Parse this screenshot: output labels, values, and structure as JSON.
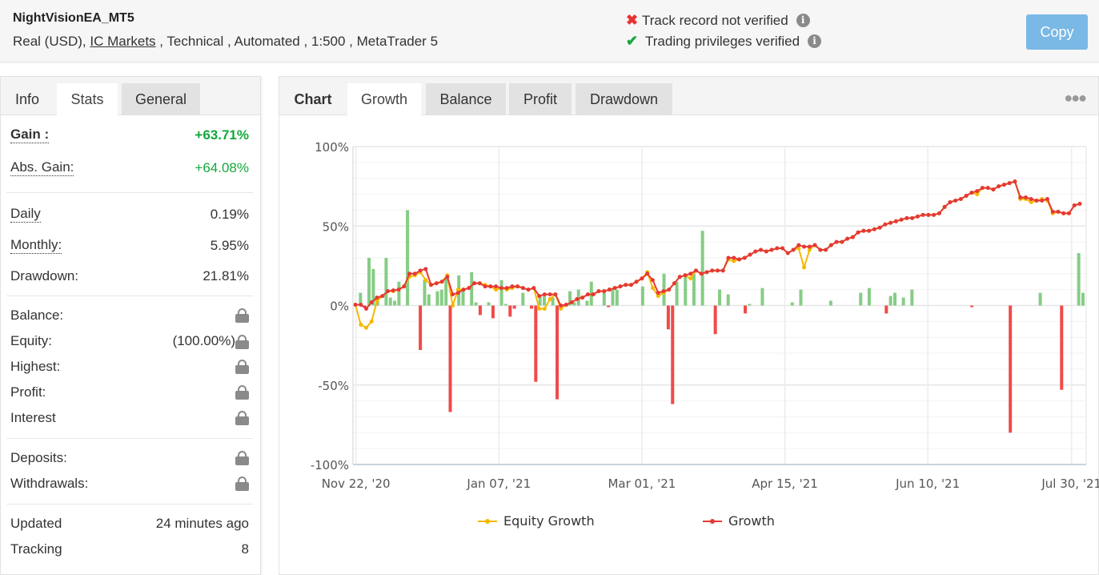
{
  "header": {
    "system_name": "NightVisionEA_MT5",
    "account_type": "Real (USD),",
    "broker": "IC Markets",
    "meta_rest": " , Technical , Automated , 1:500 , MetaTrader 5",
    "verifications": [
      {
        "status": "fail",
        "icon": "x-icon",
        "label": "Track record not verified"
      },
      {
        "status": "ok",
        "icon": "check-icon",
        "label": "Trading privileges verified"
      }
    ],
    "copy_label": "Copy"
  },
  "left_panel": {
    "tabs": [
      "Info",
      "Stats",
      "General"
    ],
    "active_tab": "Stats",
    "gain_label": "Gain :",
    "gain_value": "+63.71%",
    "abs_gain_label": "Abs. Gain:",
    "abs_gain_value": "+64.08%",
    "daily_label": "Daily",
    "daily_value": "0.19%",
    "monthly_label": "Monthly:",
    "monthly_value": "5.95%",
    "drawdown_label": "Drawdown:",
    "drawdown_value": "21.81%",
    "balance_label": "Balance:",
    "equity_label": "Equity:",
    "equity_value": "(100.00%)",
    "highest_label": "Highest:",
    "profit_label": "Profit:",
    "interest_label": "Interest",
    "deposits_label": "Deposits:",
    "withdrawals_label": "Withdrawals:",
    "updated_label": "Updated",
    "updated_value": "24 minutes ago",
    "tracking_label": "Tracking",
    "tracking_value": "8"
  },
  "chart_panel": {
    "tabs": [
      "Chart",
      "Growth",
      "Balance",
      "Profit",
      "Drawdown"
    ],
    "active_tab": "Growth",
    "more_icon": "more-dots-icon"
  },
  "colors": {
    "growth": "#e53935",
    "equity": "#f5b800",
    "bar_pos": "#86cc86",
    "bar_neg": "#f04a4a"
  },
  "chart_data": {
    "type": "line",
    "title": "",
    "xlabel": "",
    "ylabel": "",
    "ylim": [
      -100,
      100
    ],
    "yticks": [
      "100%",
      "50%",
      "0%",
      "-50%",
      "-100%"
    ],
    "ytick_values": [
      100,
      50,
      0,
      -50,
      -100
    ],
    "xticks": [
      "Nov 22, '20",
      "Jan 07, '21",
      "Mar 01, '21",
      "Apr 15, '21",
      "Jun 10, '21",
      "Jul 30, '21"
    ],
    "xtick_positions": [
      0.004,
      0.199,
      0.394,
      0.589,
      0.784,
      0.98
    ],
    "grid": true,
    "legend": {
      "position": "bottom",
      "entries": [
        "Equity Growth",
        "Growth"
      ]
    },
    "series": [
      {
        "name": "Growth",
        "values": [
          0.5,
          0.5,
          -2,
          2,
          5,
          6,
          9,
          9.5,
          10,
          12,
          20,
          20,
          22,
          23,
          13,
          14,
          15,
          18,
          7,
          8,
          10,
          11,
          14,
          14,
          12,
          12,
          12,
          11,
          11,
          12,
          12,
          11,
          10,
          11,
          6,
          7,
          7,
          7,
          0,
          0.5,
          2,
          4,
          5,
          7,
          7,
          9,
          9,
          10,
          11,
          12,
          13,
          13,
          15,
          17,
          20,
          16,
          8,
          9,
          10,
          14,
          18,
          19,
          20,
          22,
          20,
          21,
          22,
          22,
          22,
          30,
          30,
          29,
          30,
          32,
          34,
          35,
          34,
          35,
          36,
          36,
          33,
          35,
          38,
          37,
          37,
          38,
          35,
          35,
          38,
          40,
          40,
          42,
          43,
          46,
          47,
          47,
          48,
          49,
          51,
          52,
          53,
          54,
          55,
          55,
          56,
          57,
          57,
          57,
          58,
          62,
          65,
          66,
          67,
          69,
          71,
          72,
          74,
          74,
          73,
          75,
          76,
          77,
          78,
          68,
          68,
          67,
          66,
          66,
          67,
          59,
          59,
          58,
          58,
          63,
          64
        ]
      },
      {
        "name": "Equity Growth",
        "values": [
          0.5,
          -12,
          -14,
          -10,
          3,
          6,
          9,
          9,
          10,
          12,
          18,
          19,
          21,
          16,
          13,
          14,
          15,
          19,
          0,
          10,
          10,
          11,
          14,
          14,
          13,
          12,
          10,
          11,
          10,
          11,
          12,
          11,
          10,
          11,
          -2,
          -2,
          4,
          7,
          -2,
          0.5,
          2,
          4,
          5,
          7,
          7,
          9,
          9,
          10,
          11,
          12,
          13,
          13,
          15,
          17,
          21,
          11,
          6,
          8,
          10,
          14,
          18,
          19,
          17,
          22,
          20,
          21,
          22,
          22,
          22,
          29,
          28,
          29,
          30,
          32,
          34,
          35,
          34,
          35,
          36,
          36,
          33,
          35,
          36,
          24,
          35,
          38,
          35,
          35,
          38,
          40,
          40,
          42,
          43,
          46,
          47,
          47,
          48,
          49,
          51,
          52,
          53,
          54,
          55,
          55,
          56,
          57,
          57,
          57,
          58,
          62,
          65,
          66,
          67,
          69,
          71,
          70,
          74,
          74,
          73,
          75,
          76,
          77,
          78,
          67,
          67,
          65,
          66,
          67,
          66,
          58,
          59,
          58,
          58,
          63,
          64
        ]
      },
      {
        "name": "Profit bars",
        "values": [
          0,
          8,
          -1,
          30,
          23,
          3,
          0,
          30,
          5,
          3,
          15,
          0,
          60,
          0,
          0,
          -28,
          16,
          7,
          0,
          9,
          10,
          17,
          -67,
          0,
          19,
          9,
          0,
          21,
          2,
          -6,
          0,
          2,
          -8,
          0,
          16,
          1,
          -7,
          -2,
          0,
          8,
          0,
          -2,
          -48,
          6,
          6,
          0,
          5,
          -59,
          0,
          0,
          9,
          2,
          10,
          0,
          3,
          15,
          0,
          0,
          9,
          -1,
          11,
          10,
          0,
          0,
          0,
          0,
          0,
          12,
          0,
          0,
          0,
          0,
          20,
          -15,
          -62,
          15,
          0,
          19,
          0,
          20,
          0,
          47,
          0,
          0,
          -18,
          10,
          0,
          7,
          0,
          0,
          0,
          -5,
          1,
          0,
          0,
          11,
          0,
          0,
          0,
          0,
          0,
          0,
          2,
          0,
          10,
          0,
          0,
          0,
          0,
          0,
          0,
          3,
          0,
          0,
          0,
          0,
          0,
          0,
          8,
          0,
          11,
          0,
          0,
          0,
          -5,
          6,
          8,
          0,
          5,
          0,
          10,
          0,
          0,
          0,
          0,
          0,
          0,
          0,
          0,
          0,
          0,
          0,
          0,
          0,
          -1,
          0,
          0,
          0,
          0,
          0,
          0,
          0,
          0,
          -80,
          0,
          0,
          0,
          0,
          0,
          0,
          8,
          0,
          0,
          0,
          0,
          -53,
          0,
          0,
          0,
          33,
          8
        ]
      }
    ]
  }
}
